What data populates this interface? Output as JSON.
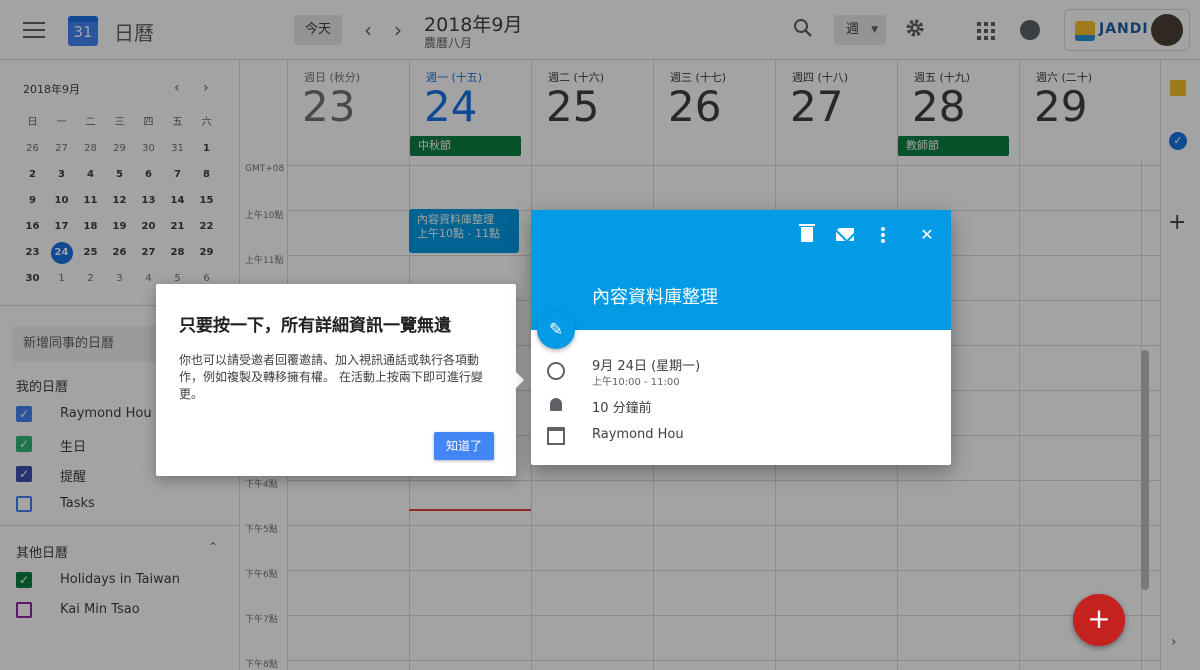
{
  "header": {
    "app_name": "日曆",
    "logo_day": "31",
    "today_label": "今天",
    "prev_label": "‹",
    "next_label": "›",
    "period": "2018年9月",
    "period_sub": "農曆八月",
    "view_label": "週",
    "account_brand": "JANDI"
  },
  "mini_calendar": {
    "title": "2018年9月",
    "weekday_heads": [
      "日",
      "一",
      "二",
      "三",
      "四",
      "五",
      "六"
    ],
    "weeks": [
      [
        "26",
        "27",
        "28",
        "29",
        "30",
        "31",
        "1"
      ],
      [
        "2",
        "3",
        "4",
        "5",
        "6",
        "7",
        "8"
      ],
      [
        "9",
        "10",
        "11",
        "12",
        "13",
        "14",
        "15"
      ],
      [
        "16",
        "17",
        "18",
        "19",
        "20",
        "21",
        "22"
      ],
      [
        "23",
        "24",
        "25",
        "26",
        "27",
        "28",
        "29"
      ],
      [
        "30",
        "1",
        "2",
        "3",
        "4",
        "5",
        "6"
      ]
    ],
    "today": "24"
  },
  "sidebar": {
    "add_coworker_placeholder": "新增同事的日曆",
    "my_calendars_title": "我的日曆",
    "my_calendars": [
      {
        "label": "Raymond Hou",
        "color": "#4285f4",
        "checked": true
      },
      {
        "label": "生日",
        "color": "#33b679",
        "checked": true
      },
      {
        "label": "提醒",
        "color": "#3f51b5",
        "checked": true
      },
      {
        "label": "Tasks",
        "color": "#4285f4",
        "checked": false
      }
    ],
    "other_calendars_title": "其他日曆",
    "other_calendars": [
      {
        "label": "Holidays in Taiwan",
        "color": "#0b8043",
        "checked": true
      },
      {
        "label": "Kai Min Tsao",
        "color": "#8e24aa",
        "checked": false
      }
    ]
  },
  "week": {
    "days": [
      {
        "name": "週日 (秋分)",
        "num": "23",
        "state": "past"
      },
      {
        "name": "週一 (十五)",
        "num": "24",
        "state": "today"
      },
      {
        "name": "週二 (十六)",
        "num": "25",
        "state": "future"
      },
      {
        "name": "週三 (十七)",
        "num": "26",
        "state": "future"
      },
      {
        "name": "週四 (十八)",
        "num": "27",
        "state": "future"
      },
      {
        "name": "週五 (十九)",
        "num": "28",
        "state": "future"
      },
      {
        "name": "週六 (二十)",
        "num": "29",
        "state": "future"
      }
    ],
    "holidays": [
      {
        "day": "24",
        "label": "中秋節"
      },
      {
        "day": "28",
        "label": "教師節"
      }
    ],
    "timezone": "GMT+08",
    "hours": [
      "上午10點",
      "上午11點",
      "下午4點",
      "下午5點",
      "下午6點",
      "下午7點",
      "下午8點"
    ]
  },
  "event": {
    "title": "內容資料庫整理",
    "time": "上午10點 - 11點"
  },
  "tooltip": {
    "title": "只要按一下，所有詳細資訊一覽無遺",
    "body": "你也可以請受邀者回覆邀請、加入視訊通話或執行各項動作，例如複製及轉移擁有權。 在活動上按兩下即可進行變更。",
    "button": "知道了"
  },
  "popover": {
    "title": "內容資料庫整理",
    "date": "9月 24日 (星期一)",
    "time": "上午10:00 - 11:00",
    "reminder": "10 分鐘前",
    "calendar": "Raymond Hou"
  },
  "colors": {
    "accent": "#1a73e8",
    "event": "#039be5",
    "holiday": "#0b8043",
    "fab": "#c5221f"
  }
}
